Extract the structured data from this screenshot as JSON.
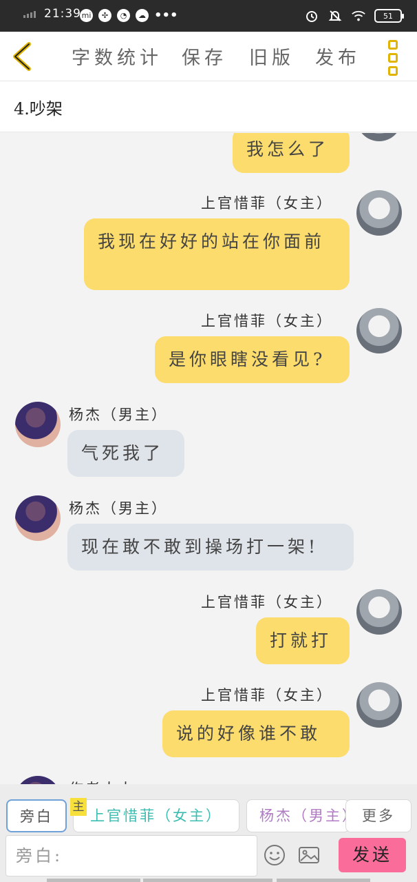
{
  "status_bar": {
    "time": "21:39",
    "notif_icons": [
      "mi-icon",
      "fan-icon",
      "gauge-icon",
      "cloud-icon"
    ],
    "more": "•••",
    "battery": "51"
  },
  "toolbar": {
    "word_count": "字数统计",
    "save": "保存",
    "old_version": "旧版",
    "publish": "发布"
  },
  "chapter": {
    "title": "4.吵架"
  },
  "messages": [
    {
      "speaker": "",
      "text": "我怎么了",
      "side": "right"
    },
    {
      "speaker": "上官惜菲（女主）",
      "text": "我现在好好的站在你面前",
      "side": "right"
    },
    {
      "speaker": "上官惜菲（女主）",
      "text": "是你眼瞎没看见?",
      "side": "right"
    },
    {
      "speaker": "杨杰（男主）",
      "text": "气死我了",
      "side": "left"
    },
    {
      "speaker": "杨杰（男主）",
      "text": "现在敢不敢到操场打一架!",
      "side": "left"
    },
    {
      "speaker": "上官惜菲（女主）",
      "text": "打就打",
      "side": "right"
    },
    {
      "speaker": "上官惜菲（女主）",
      "text": "说的好像谁不敢",
      "side": "right"
    },
    {
      "speaker": "作者大大",
      "text": "",
      "side": "left"
    }
  ],
  "composer": {
    "roles": [
      "旁白",
      "上官惜菲（女主）",
      "杨杰（男主）",
      "更多"
    ],
    "main_tag": "主",
    "placeholder": "旁白:",
    "send": "发送"
  },
  "colors": {
    "female_bubble": "#fcdc6c",
    "male_bubble": "#dfe3ea",
    "send_button": "#fa6c99",
    "accent": "#e0b400"
  }
}
